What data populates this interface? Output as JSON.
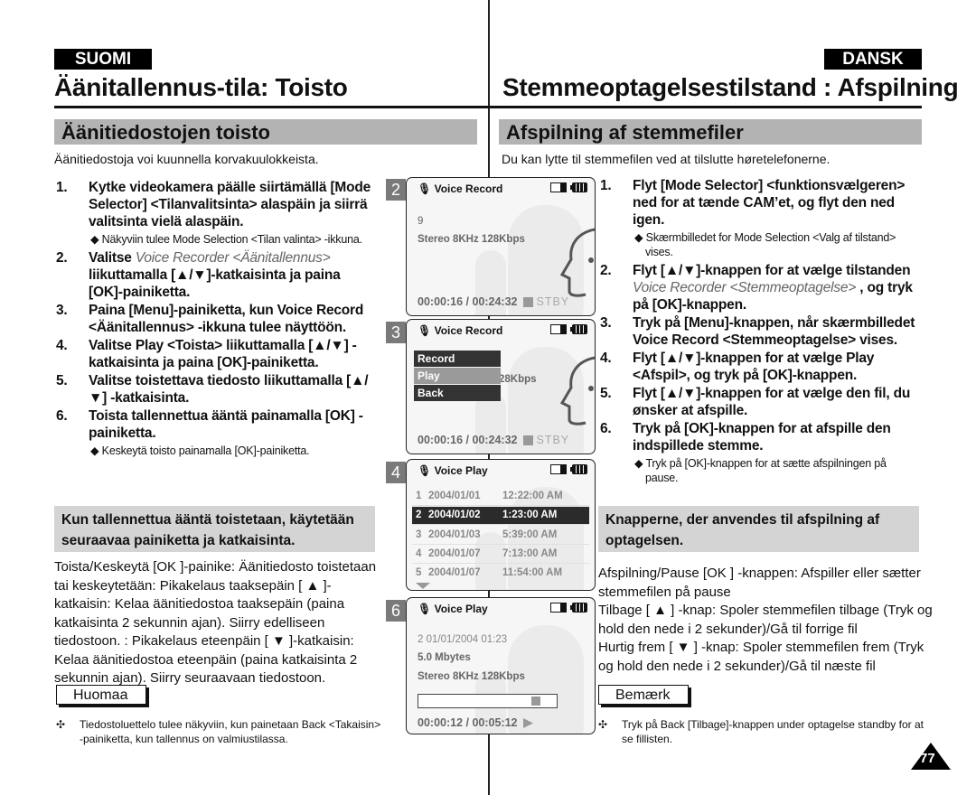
{
  "left": {
    "language": "SUOMI",
    "title": "Äänitallennus-tila: Toisto",
    "section": "Äänitiedostojen toisto",
    "intro": "Äänitiedostoja voi kuunnella korvakuulokkeista.",
    "steps": [
      {
        "num": "1.",
        "text": "Kytke videokamera päälle siirtämällä [Mode Selector] <Tilanvalitsinta> alaspäin ja siirrä valitsinta vielä alaspäin.",
        "sub": "◆ Näkyviin tulee Mode Selection <Tilan valinta> -ikkuna."
      },
      {
        "num": "2.",
        "pre": "Valitse ",
        "italic": "Voice Recorder <Äänitallennus>",
        "text": " liikuttamalla [▲/▼]-katkaisinta ja paina [OK]-painiketta."
      },
      {
        "num": "3.",
        "text": "Paina [Menu]-painiketta, kun Voice Record <Äänitallennus> -ikkuna tulee näyttöön."
      },
      {
        "num": "4.",
        "text": "Valitse Play <Toista> liikuttamalla [▲/▼] -katkaisinta ja paina [OK]-painiketta."
      },
      {
        "num": "5.",
        "text": "Valitse toistettava tiedosto liikuttamalla [▲/▼] -katkaisinta."
      },
      {
        "num": "6.",
        "text": "Toista tallennettua ääntä painamalla [OK] -painiketta.",
        "sub": "◆ Keskeytä toisto painamalla [OK]-painiketta."
      }
    ],
    "buttons_heading": "Kun tallennettua ääntä toistetaan, käytetään seuraavaa painiketta ja katkaisinta.",
    "buttons_body": "Toista/Keskeytä [OK ]-painike: Äänitiedosto toistetaan tai keskeytetään: Pikakelaus taaksepäin [ ▲ ]-katkaisin: Kelaa äänitiedostoa taaksepäin (paina katkaisinta 2 sekunnin ajan). Siirry edelliseen tiedostoon. : Pikakelaus eteenpäin  [ ▼ ]-katkaisin: Kelaa äänitiedostoa eteenpäin (paina katkaisinta 2 sekunnin ajan). Siirry seuraavaan tiedostoon.",
    "note_label": "Huomaa",
    "note_bullet": "✣",
    "note_text": "Tiedostoluettelo tulee näkyviin, kun painetaan Back <Takaisin> -painiketta, kun tallennus on valmiustilassa."
  },
  "right": {
    "language": "DANSK",
    "title": "Stemmeoptagelsestilstand : Afspilning",
    "section": "Afspilning af stemmefiler",
    "intro": "Du kan lytte til stemmefilen ved at tilslutte høretelefonerne.",
    "steps": [
      {
        "num": "1.",
        "text": "Flyt [Mode Selector] <funktionsvælgeren> ned for at tænde CAM’et, og flyt den ned igen.",
        "sub": "◆ Skærmbilledet for Mode Selection <Valg af tilstand> vises."
      },
      {
        "num": "2.",
        "pre": "Flyt [▲/▼]-knappen for at vælge tilstanden ",
        "italic": "Voice Recorder <Stemmeoptagelse>",
        "text": " , og tryk på [OK]-knappen."
      },
      {
        "num": "3.",
        "text": "Tryk på [Menu]-knappen, når skærmbilledet Voice Record <Stemmeoptagelse> vises."
      },
      {
        "num": "4.",
        "text": "Flyt [▲/▼]-knappen for at vælge Play <Afspil>, og tryk på [OK]-knappen."
      },
      {
        "num": "5.",
        "text": "Flyt [▲/▼]-knappen for at vælge den fil, du ønsker at afspille."
      },
      {
        "num": "6.",
        "text": "Tryk på [OK]-knappen for at afspille den indspillede stemme.",
        "sub": "◆ Tryk på [OK]-knappen for at sætte afspilningen på pause."
      }
    ],
    "buttons_heading": "Knapperne, der anvendes til afspilning af optagelsen.",
    "buttons_lines": [
      "Afspilning/Pause [OK ] -knappen: Afspiller eller sætter stemmefilen på pause",
      "Tilbage [ ▲ ] -knap: Spoler stemmefilen tilbage (Tryk og hold den nede i 2 sekunder)/Gå til forrige fil",
      "Hurtig frem [ ▼ ] -knap: Spoler stemmefilen frem (Tryk og hold den nede i 2 sekunder)/Gå til næste fil"
    ],
    "note_label": "Bemærk",
    "note_bullet": "✣",
    "note_text": "Tryk på Back  [Tilbage]-knappen under optagelse standby for at se fillisten."
  },
  "screens": {
    "s2": {
      "step": "2",
      "header": "Voice Record",
      "line1": "9",
      "line2": "Stereo  8KHz  128Kbps",
      "time": "00:00:16 / 00:24:32",
      "status": "STBY"
    },
    "s3": {
      "step": "3",
      "header": "Voice Record",
      "menu": [
        "Record",
        "Play",
        "Back"
      ],
      "selected_menu": "Play",
      "partial": "28Kbps",
      "time": "00:00:16 / 00:24:32",
      "status": "STBY"
    },
    "s4": {
      "step": "4",
      "header": "Voice Play",
      "files": [
        {
          "n": "1",
          "date": "2004/01/01",
          "time": "12:22:00 AM"
        },
        {
          "n": "2",
          "date": "2004/01/02",
          "time": "1:23:00 AM"
        },
        {
          "n": "3",
          "date": "2004/01/03",
          "time": "5:39:00 AM"
        },
        {
          "n": "4",
          "date": "2004/01/07",
          "time": "7:13:00 AM"
        },
        {
          "n": "5",
          "date": "2004/01/07",
          "time": "11:54:00 AM"
        }
      ],
      "selected_index": 1
    },
    "s6": {
      "step": "6",
      "header": "Voice Play",
      "line1": "2  01/01/2004  01:23",
      "line2": "5.0 Mbytes",
      "line3": "Stereo  8KHz  128Kbps",
      "progress_fraction": 0.9,
      "time": "00:00:12 / 00:05:12"
    }
  },
  "page_number": "77"
}
